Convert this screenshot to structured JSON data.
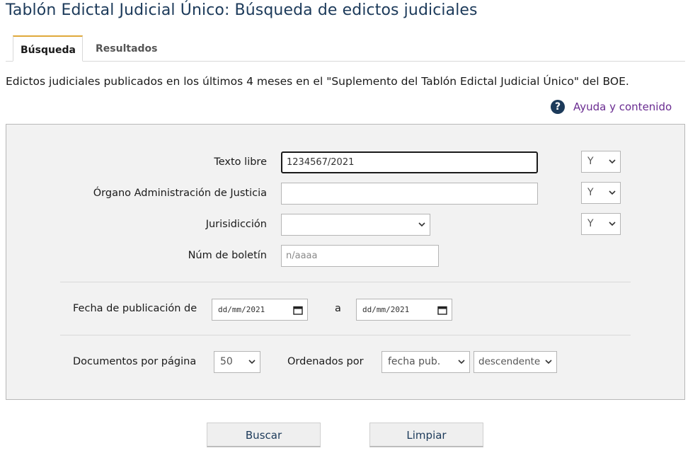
{
  "title": "Tablón Edictal Judicial Único: Búsqueda de edictos judiciales",
  "tabs": [
    {
      "label": "Búsqueda",
      "active": true
    },
    {
      "label": "Resultados",
      "active": false
    }
  ],
  "intro": "Edictos judiciales publicados en los últimos 4 meses en el \"Suplemento del Tablón Edictal Judicial Único\" del BOE.",
  "help": {
    "icon": "question-circle-icon",
    "label": "Ayuda y contenido"
  },
  "form": {
    "texto_libre": {
      "label": "Texto libre",
      "value": "1234567/2021",
      "operator": "Y"
    },
    "organo": {
      "label": "Órgano Administración de Justicia",
      "value": "",
      "operator": "Y"
    },
    "jurisdiccion": {
      "label": "Jurisidicción",
      "value": "",
      "operator": "Y"
    },
    "num_boletin": {
      "label": "Núm de boletín",
      "value": "",
      "placeholder": "n/aaaa"
    },
    "fecha": {
      "label": "Fecha de publicación de",
      "from": "dd/mm/2021",
      "separator": "a",
      "to": "dd/mm/2021"
    },
    "docs_por_pagina": {
      "label": "Documentos por página",
      "value": "50"
    },
    "ordenados": {
      "label": "Ordenados por",
      "field": "fecha pub.",
      "direction": "descendente"
    }
  },
  "buttons": {
    "search": "Buscar",
    "clear": "Limpiar"
  },
  "colors": {
    "title": "#1c3a5a",
    "tab_accent": "#e0a93a",
    "link": "#6a2c91",
    "panel": "#f2f2f2"
  }
}
